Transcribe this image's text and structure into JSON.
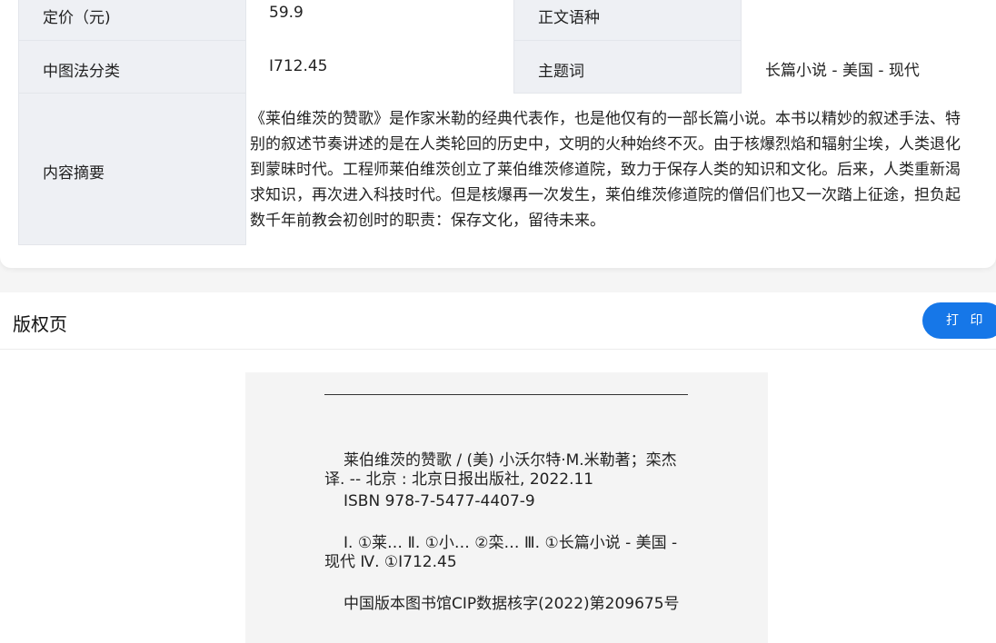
{
  "info": {
    "price_label": "定价（元)",
    "price_value": "59.9",
    "language_label": "正文语种",
    "language_value": "",
    "clc_label": "中图法分类",
    "clc_value": "I712.45",
    "subject_label": "主题词",
    "subject_value": "长篇小说 - 美国 - 现代",
    "abstract_label": "内容摘要",
    "abstract_value": "《莱伯维茨的赞歌》是作家米勒的经典代表作，也是他仅有的一部长篇小说。本书以精妙的叙述手法、特别的叙述节奏讲述的是在人类轮回的历史中，文明的火种始终不灭。由于核爆烈焰和辐射尘埃，人类退化到蒙昧时代。工程师莱伯维茨创立了莱伯维茨修道院，致力于保存人类的知识和文化。后来，人类重新渴求知识，再次进入科技时代。但是核爆再一次发生，莱伯维茨修道院的僧侣们也又一次踏上征途，担负起数千年前教会初创时的职责：保存文化，留待未来。"
  },
  "copyright": {
    "title": "版权页",
    "print_button": "打 印",
    "cip_line1": "莱伯维茨的赞歌 / (美) 小沃尔特·M.米勒著；栾杰译. -- 北京 : 北京日报出版社, 2022.11",
    "cip_isbn": "ISBN 978-7-5477-4407-9",
    "cip_subjects": "Ⅰ. ①莱… Ⅱ. ①小… ②栾… Ⅲ. ①长篇小说 - 美国 - 现代 Ⅳ. ①I712.45",
    "cip_number": "中国版本图书馆CIP数据核字(2022)第209675号"
  }
}
